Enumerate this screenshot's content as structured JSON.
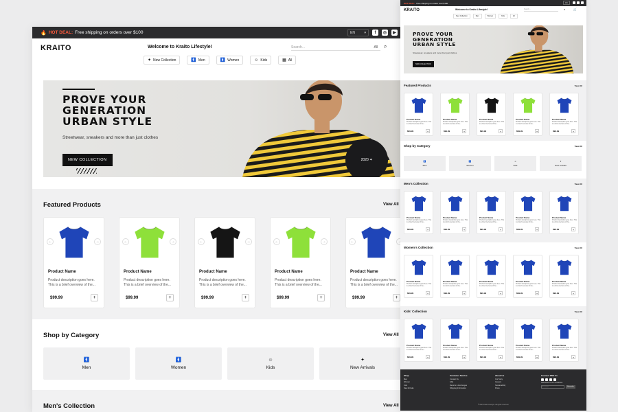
{
  "promo": {
    "hot_label": "HOT DEAL:",
    "text": "Free shipping on orders over $100",
    "lang": "EN"
  },
  "header": {
    "logo": "KRAITO",
    "welcome": "Welcome to Kraito Lifestyle!",
    "search_placeholder": "Search...",
    "search_filter": "All"
  },
  "nav": [
    {
      "label": "New Collection",
      "icon": "sparkle-icon"
    },
    {
      "label": "Men",
      "icon": "man-icon"
    },
    {
      "label": "Women",
      "icon": "woman-icon"
    },
    {
      "label": "Kids",
      "icon": "kid-face-icon"
    },
    {
      "label": "All",
      "icon": "grid-icon"
    }
  ],
  "hero": {
    "title_line1": "PROVE YOUR",
    "title_line2": "GENERATION",
    "title_line3": "URBAN STYLE",
    "subtitle": "Streetwear, sneakers and more than just clothes",
    "cta": "NEW COLLECTION"
  },
  "featured": {
    "title": "Featured Products",
    "view_all": "View All",
    "products": [
      {
        "name": "Product Name",
        "desc": "Product description goes here. This is a brief overview of the...",
        "price": "$99.99",
        "color": "#1f45b8"
      },
      {
        "name": "Product Name",
        "desc": "Product description goes here. This is a brief overview of the...",
        "price": "$99.99",
        "color": "#8ee03a"
      },
      {
        "name": "Product Name",
        "desc": "Product description goes here. This is a brief overview of the...",
        "price": "$99.99",
        "color": "#151515"
      },
      {
        "name": "Product Name",
        "desc": "Product description goes here. This is a brief overview of the...",
        "price": "$99.99",
        "color": "#8ee03a"
      },
      {
        "name": "Product Name",
        "desc": "Product description goes here. This is a brief overview of the...",
        "price": "$99.99",
        "color": "#1f45b8"
      }
    ]
  },
  "categories": {
    "title": "Shop by Category",
    "view_all": "View All",
    "items": [
      {
        "label": "Men",
        "icon": "man-icon"
      },
      {
        "label": "Women",
        "icon": "woman-icon"
      },
      {
        "label": "Kids",
        "icon": "kid-face-icon"
      },
      {
        "label": "New Arrivals",
        "icon": "sparkle-icon"
      }
    ]
  },
  "collections": [
    {
      "title": "Men's Collection",
      "view_all": "View All"
    },
    {
      "title": "Women's Collection",
      "view_all": "View All"
    },
    {
      "title": "Kids' Collection",
      "view_all": "View All"
    }
  ],
  "collection_product": {
    "name": "Product Name",
    "desc": "Product description goes here. This is a brief overview of the...",
    "price": "$99.99",
    "color": "#1f45b8"
  },
  "footer": {
    "columns": [
      {
        "heading": "Shop",
        "links": [
          "Men",
          "Women",
          "Kids",
          "New Arrivals"
        ]
      },
      {
        "heading": "Customer Service",
        "links": [
          "Contact Us",
          "FAQ",
          "Returns & Exchanges",
          "Shipping Information"
        ]
      },
      {
        "heading": "About Us",
        "links": [
          "Our Story",
          "Careers",
          "Sustainability",
          "Press"
        ]
      },
      {
        "heading": "Connect With Us",
        "links": [
          "Subscribe to our newsletter"
        ]
      }
    ],
    "email_placeholder": "Your email",
    "subscribe": "Subscribe",
    "copyright": "© 2024 Kraito Lifestyle. All rights reserved."
  },
  "colors": {
    "dark": "#2b2b2d",
    "hot": "#ff5a3c",
    "blue_tee": "#1f45b8",
    "green_tee": "#8ee03a"
  }
}
